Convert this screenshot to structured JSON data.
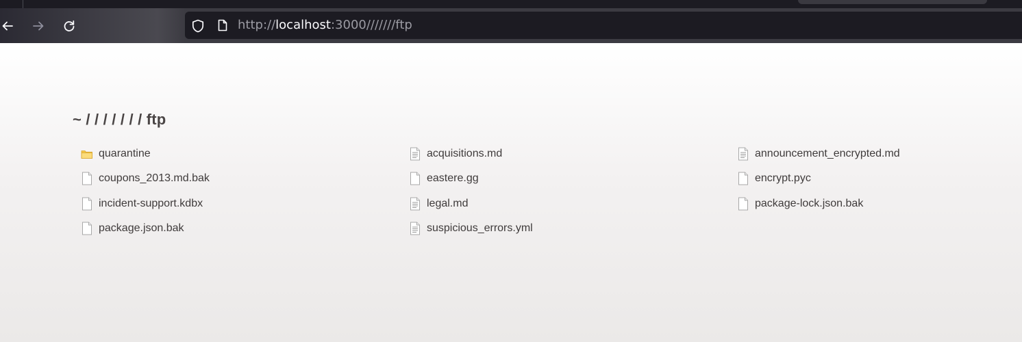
{
  "browser": {
    "url": {
      "scheme": "http://",
      "host": "localhost",
      "rest": ":3000///////ftp"
    }
  },
  "listing": {
    "breadcrumb": "~ / / / / / / / ftp",
    "files": [
      {
        "name": "quarantine",
        "icon": "folder-icon"
      },
      {
        "name": "acquisitions.md",
        "icon": "text-file-icon"
      },
      {
        "name": "announcement_encrypted.md",
        "icon": "text-file-icon"
      },
      {
        "name": "coupons_2013.md.bak",
        "icon": "file-icon"
      },
      {
        "name": "eastere.gg",
        "icon": "file-icon"
      },
      {
        "name": "encrypt.pyc",
        "icon": "file-icon"
      },
      {
        "name": "incident-support.kdbx",
        "icon": "file-icon"
      },
      {
        "name": "legal.md",
        "icon": "text-file-icon"
      },
      {
        "name": "package-lock.json.bak",
        "icon": "file-icon"
      },
      {
        "name": "package.json.bak",
        "icon": "file-icon"
      },
      {
        "name": "suspicious_errors.yml",
        "icon": "text-file-icon"
      }
    ]
  },
  "colors": {
    "folder": "#f4c64a",
    "text": "#3f3b3b",
    "toolbar": "#3c3b42",
    "urlbar": "#1c1b22"
  }
}
